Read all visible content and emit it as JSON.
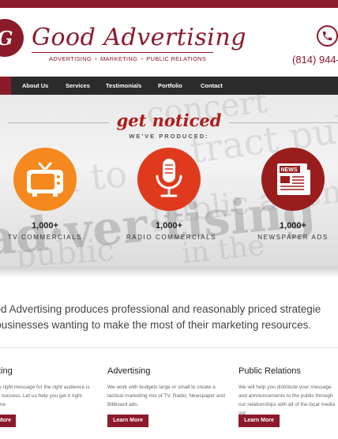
{
  "header": {
    "logo_letter": "G",
    "brand": "Good Advertising",
    "tagline": [
      "ADVERTISING",
      "MARKETING",
      "PUBLIC RELATIONS"
    ],
    "phone": "(814) 944-"
  },
  "nav": {
    "items": [
      "About Us",
      "Services",
      "Testimonials",
      "Portfolio",
      "Contact"
    ]
  },
  "hero": {
    "title": "get noticed",
    "subtitle": "WE'VE PRODUCED:",
    "background_words": [
      "concert",
      "tract publ",
      "sed to",
      "ad·ver·tising",
      "public attentior",
      "public",
      "in the"
    ],
    "stats": [
      {
        "icon": "tv-icon",
        "count": "1,000+",
        "label": "TV COMMERCIALS",
        "color": "#f5891f"
      },
      {
        "icon": "microphone-icon",
        "count": "1,000+",
        "label": "RADIO COMMERCIALS",
        "color": "#e03a1e"
      },
      {
        "icon": "newspaper-icon",
        "count": "1,000+",
        "label": "NEWSPAPER ADS",
        "color": "#9a1d1d"
      }
    ]
  },
  "intro": {
    "line1": "ood Advertising produces professional and reasonably priced strategie",
    "line2": "r businesses wanting to make the most of their marketing resources."
  },
  "columns": [
    {
      "title": "ting",
      "text": "e right message for the right audience is r success. Let us help you get it right me.",
      "button": "More"
    },
    {
      "title": "Advertising",
      "text": "We work with budgets large or small to create a tactical marketing mix of TV, Radio, Newspaper and Billboard ads.",
      "button": "Learn More"
    },
    {
      "title": "Public Relations",
      "text": "We will help you distribute your message and announcements to the public through our relationships with all of the local media out",
      "button": "Learn More"
    }
  ],
  "colors": {
    "brand": "#8b1a2b",
    "nav": "#2b2b2b"
  }
}
